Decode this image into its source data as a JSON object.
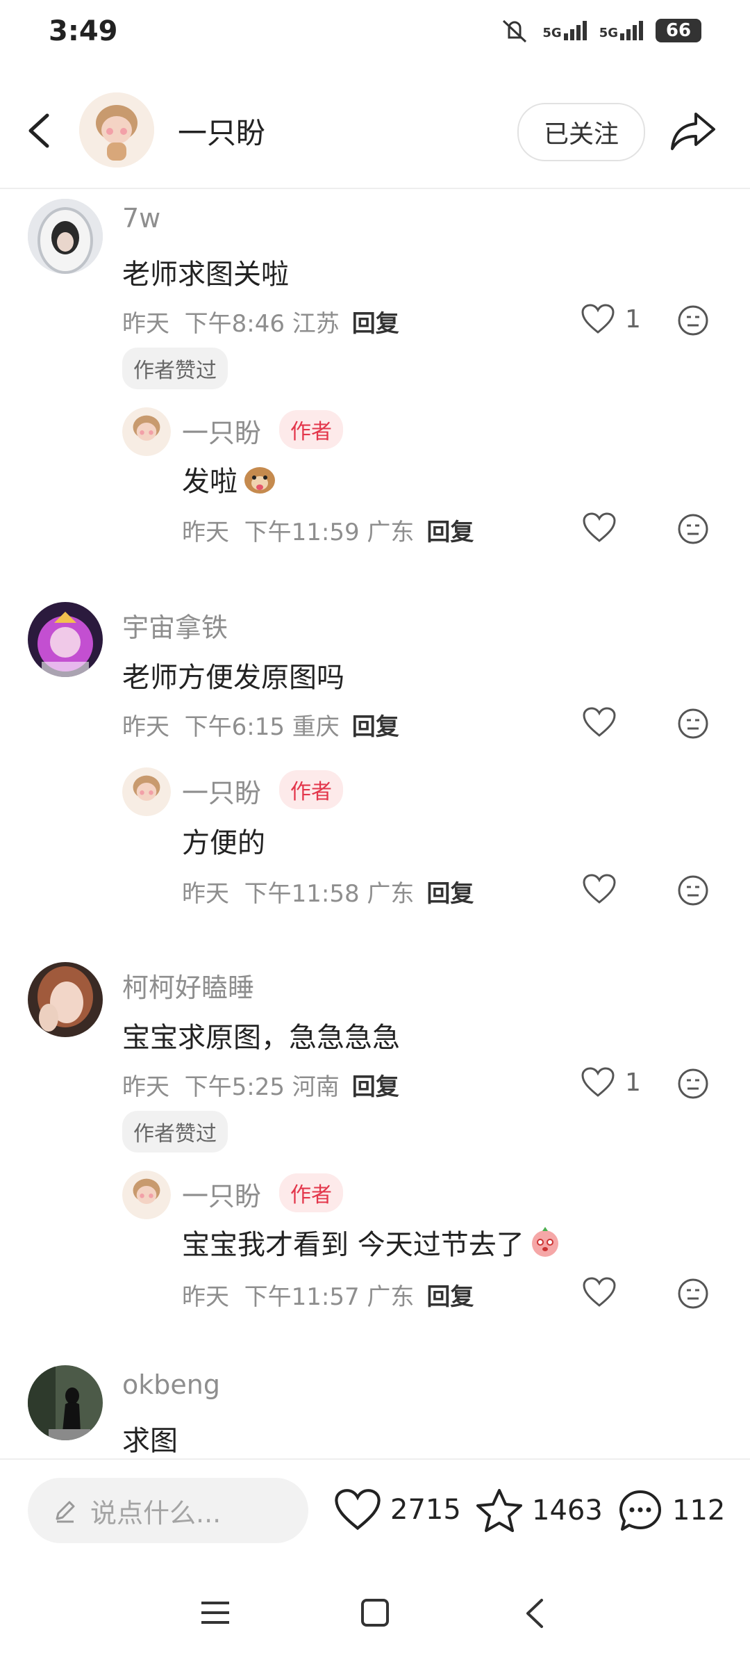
{
  "status_bar": {
    "time": "3:49",
    "signal1": "5G",
    "signal2": "5G",
    "battery": "66"
  },
  "header": {
    "author_name": "一只盼",
    "follow_label": "已关注"
  },
  "comments": [
    {
      "user": "7w",
      "text": "老师求图关啦",
      "date": "昨天",
      "time": "下午8:46",
      "location": "江苏",
      "reply_label": "回复",
      "likes": "1",
      "liked_by_author": "作者赞过",
      "author_reply": {
        "name": "一只盼",
        "tag": "作者",
        "text": "发啦",
        "date": "昨天",
        "time": "下午11:59",
        "location": "广东",
        "reply_label": "回复"
      }
    },
    {
      "user": "宇宙拿铁",
      "text": "老师方便发原图吗",
      "date": "昨天",
      "time": "下午6:15",
      "location": "重庆",
      "reply_label": "回复",
      "author_reply": {
        "name": "一只盼",
        "tag": "作者",
        "text": "方便的",
        "date": "昨天",
        "time": "下午11:58",
        "location": "广东",
        "reply_label": "回复"
      }
    },
    {
      "user": "柯柯好瞌睡",
      "text": "宝宝求原图，急急急急",
      "date": "昨天",
      "time": "下午5:25",
      "location": "河南",
      "reply_label": "回复",
      "likes": "1",
      "liked_by_author": "作者赞过",
      "author_reply": {
        "name": "一只盼",
        "tag": "作者",
        "text": "宝宝我才看到 今天过节去了",
        "date": "昨天",
        "time": "下午11:57",
        "location": "广东",
        "reply_label": "回复"
      }
    },
    {
      "user": "okbeng",
      "text": "求图"
    }
  ],
  "bottom_bar": {
    "input_placeholder": "说点什么...",
    "likes": "2715",
    "stars": "1463",
    "comments": "112"
  },
  "colors": {
    "author_tag": "#e3364b",
    "author_tag_bg": "#fdeaea",
    "muted": "#8e8e8e"
  },
  "icons": [
    "back-icon",
    "share-icon",
    "heart-icon",
    "dislike-face-icon",
    "pencil-icon",
    "star-icon",
    "comment-icon"
  ]
}
